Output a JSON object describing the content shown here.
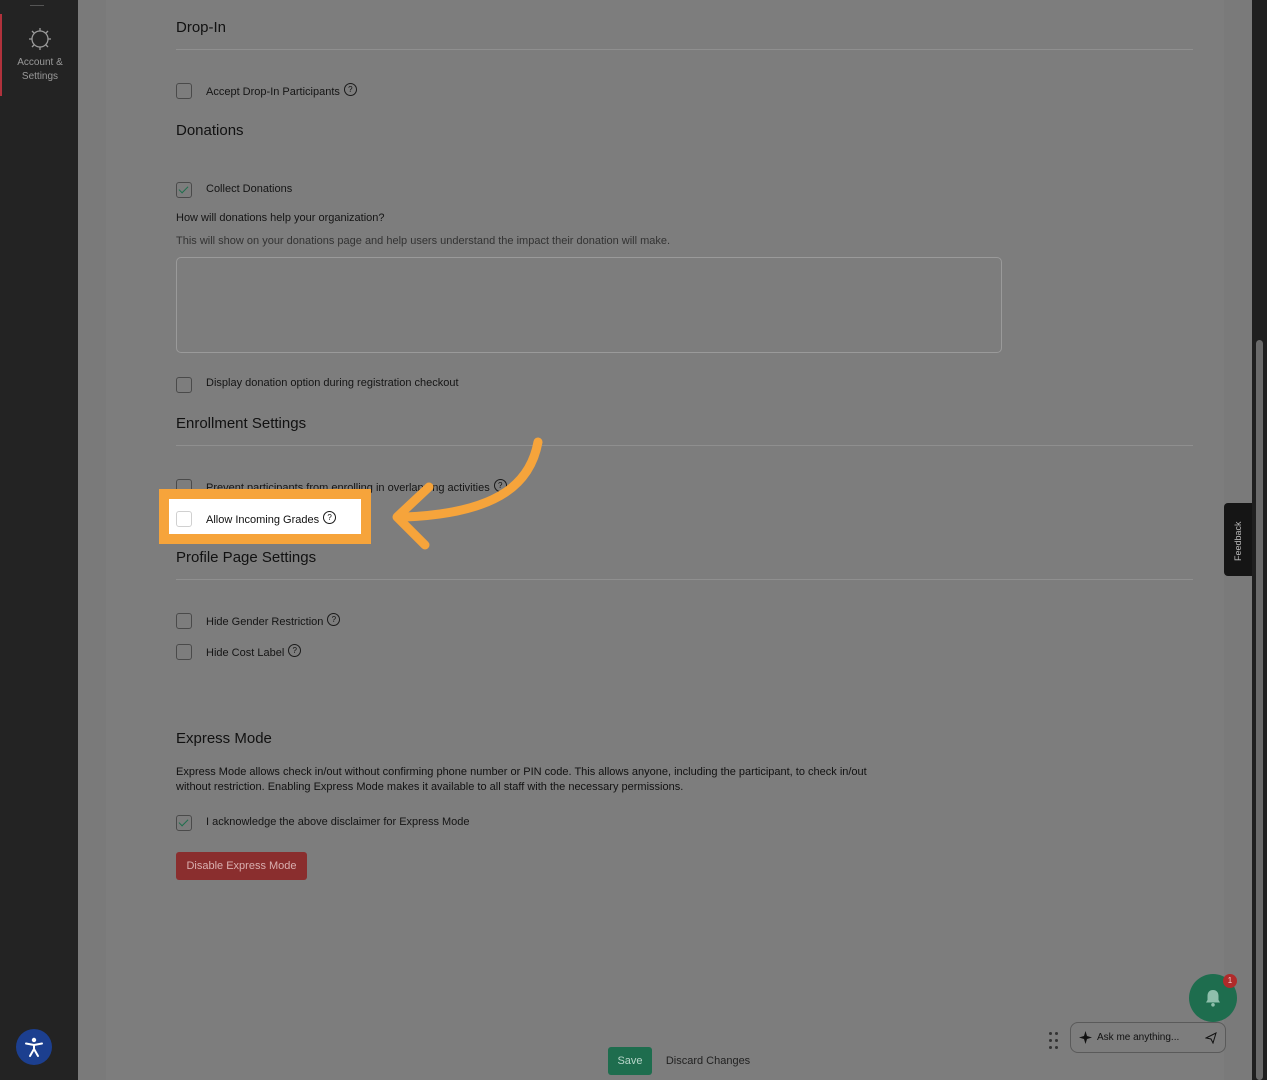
{
  "sidebar": {
    "account_settings_label": "Account & Settings",
    "accent": "#b0323c"
  },
  "sections": {
    "drop_in": {
      "title": "Drop-In",
      "accept_label": "Accept Drop-In Participants"
    },
    "donations": {
      "title": "Donations",
      "collect_label": "Collect Donations",
      "collect_checked": true,
      "question": "How will donations help your organization?",
      "hint": "This will show on your donations page and help users understand the impact their donation will make.",
      "textarea_value": "",
      "display_option_label": "Display donation option during registration checkout"
    },
    "enrollment": {
      "title": "Enrollment Settings",
      "prevent_label": "Prevent participants from enrolling in overlapping activities",
      "allow_grades_label": "Allow Incoming Grades"
    },
    "profile": {
      "title": "Profile Page Settings",
      "hide_gender_label": "Hide Gender Restriction",
      "hide_cost_label": "Hide Cost Label"
    },
    "express": {
      "title": "Express Mode",
      "description": "Express Mode allows check in/out without confirming phone number or PIN code. This allows anyone, including the participant, to check in/out without restriction. Enabling Express Mode makes it available to all staff with the necessary permissions.",
      "acknowledge_label": "I acknowledge the above disclaimer for Express Mode",
      "acknowledge_checked": true,
      "disable_button": "Disable Express Mode"
    }
  },
  "footer": {
    "save_label": "Save",
    "discard_label": "Discard Changes"
  },
  "widgets": {
    "feedback_label": "Feedback",
    "notification_count": "1",
    "ask_placeholder": "Ask me anything..."
  },
  "colors": {
    "highlight": "#f6a43b",
    "primary_green": "#1e6d4e",
    "danger_red": "#8a2e2e"
  }
}
